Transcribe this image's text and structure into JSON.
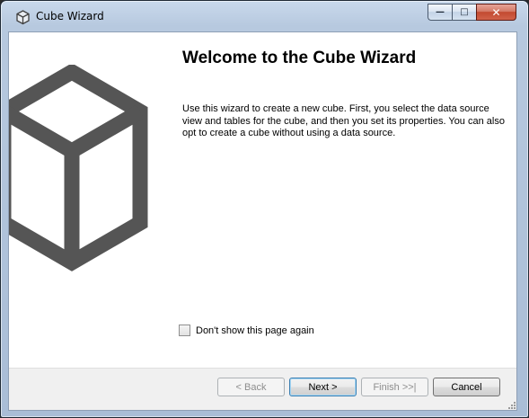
{
  "window": {
    "title": "Cube Wizard",
    "caption_buttons": {
      "minimize": "—",
      "maximize": "□",
      "close": "✕"
    }
  },
  "welcome": {
    "heading": "Welcome to the Cube Wizard",
    "description": "Use this wizard to create a new cube. First, you select the data source view and tables for the cube, and then you set its properties. You can also opt to create a cube without using a data source."
  },
  "options": {
    "dont_show_label": "Don't show this page again",
    "dont_show_checked": false
  },
  "buttons": {
    "back": "< Back",
    "next": "Next >",
    "finish": "Finish >>|",
    "cancel": "Cancel"
  },
  "icons": {
    "app": "cube-icon",
    "illustration": "cube-illustration"
  },
  "colors": {
    "cube_gray": "#555555",
    "client_bg": "#ffffff",
    "footer_bg": "#f0f0f0"
  }
}
